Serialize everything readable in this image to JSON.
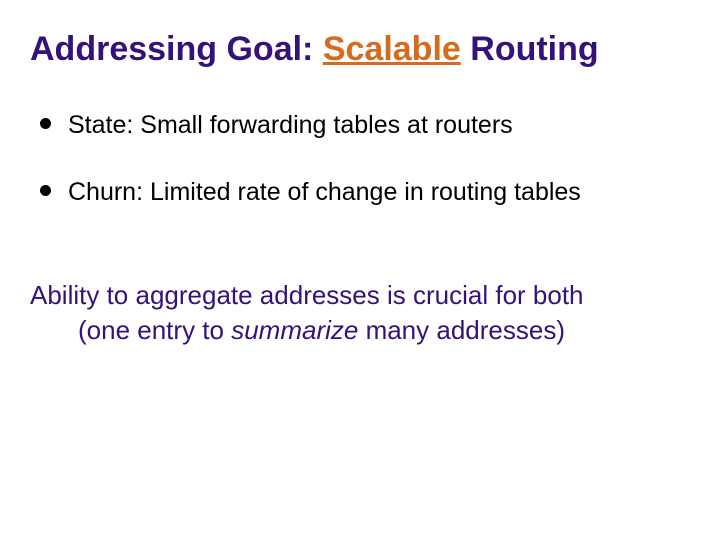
{
  "title": {
    "pre": "Addressing Goal: ",
    "emph": "Scalable",
    "post": " Routing"
  },
  "bullets": [
    "State: Small forwarding tables at routers",
    "Churn: Limited rate of change in routing tables"
  ],
  "body": {
    "line1": "Ability to aggregate addresses is crucial for both",
    "line2_pre": "(one entry to ",
    "line2_em": "summarize",
    "line2_post": " many addresses)"
  }
}
